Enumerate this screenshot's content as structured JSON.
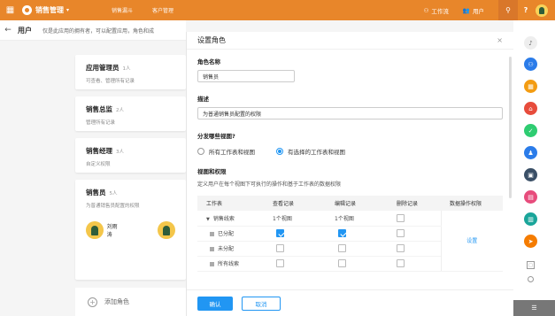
{
  "topbar": {
    "app_name": "销售管理",
    "nav": [
      "销售漏斗",
      "客户管理"
    ],
    "workflow_label": "工作流",
    "users_label": "用户",
    "search_icon": "search-icon",
    "help_icon": "?"
  },
  "header": {
    "title": "用户",
    "description": "仅是此应用的拥有者，可以配置应用，角色和成"
  },
  "roles": [
    {
      "name": "应用管理员",
      "count": "1人",
      "desc": "可查看、管理所有记录"
    },
    {
      "name": "销售总监",
      "count": "2人",
      "desc": "管理所有记录"
    },
    {
      "name": "销售经理",
      "count": "3人",
      "desc": "自定义权限"
    },
    {
      "name": "销售员",
      "count": "5人",
      "desc": "为普通销售员配置的权限",
      "member_name": "刘雨涛"
    }
  ],
  "add_role_label": "添加角色",
  "dialog": {
    "title": "设置角色",
    "close": "×",
    "role_name_label": "角色名称",
    "role_name_value": "销售员",
    "desc_label": "描述",
    "desc_value": "为普通销售员配置的权限",
    "views_label": "分发哪些视图?",
    "radio_all": "所有工作表和视图",
    "radio_selected": "有选择的工作表和视图",
    "perm_label": "视图和权限",
    "perm_desc": "定义用户在每个视图下可执行的操作和基于工作表的数据权限",
    "table": {
      "headers": [
        "工作表",
        "查看记录",
        "编辑记录",
        "删除记录",
        "数据操作权限"
      ],
      "group_row": {
        "name": "销售线索",
        "view": "1个视图",
        "edit": "1个视图"
      },
      "rows": [
        {
          "name": "已分配",
          "view": true,
          "edit": true,
          "del": false
        },
        {
          "name": "未分配",
          "view": false,
          "edit": false,
          "del": false
        },
        {
          "name": "所有线索",
          "view": false,
          "edit": false,
          "del": false
        }
      ],
      "settings_link": "设置"
    },
    "confirm": "确认",
    "cancel": "取消"
  },
  "dock_colors": [
    "#2b7ce9",
    "#f39c12",
    "#e74c3c",
    "#2ecc71",
    "#2b7ce9",
    "#3a4f66",
    "#e74c7c",
    "#1aa59a",
    "#f57c00"
  ]
}
